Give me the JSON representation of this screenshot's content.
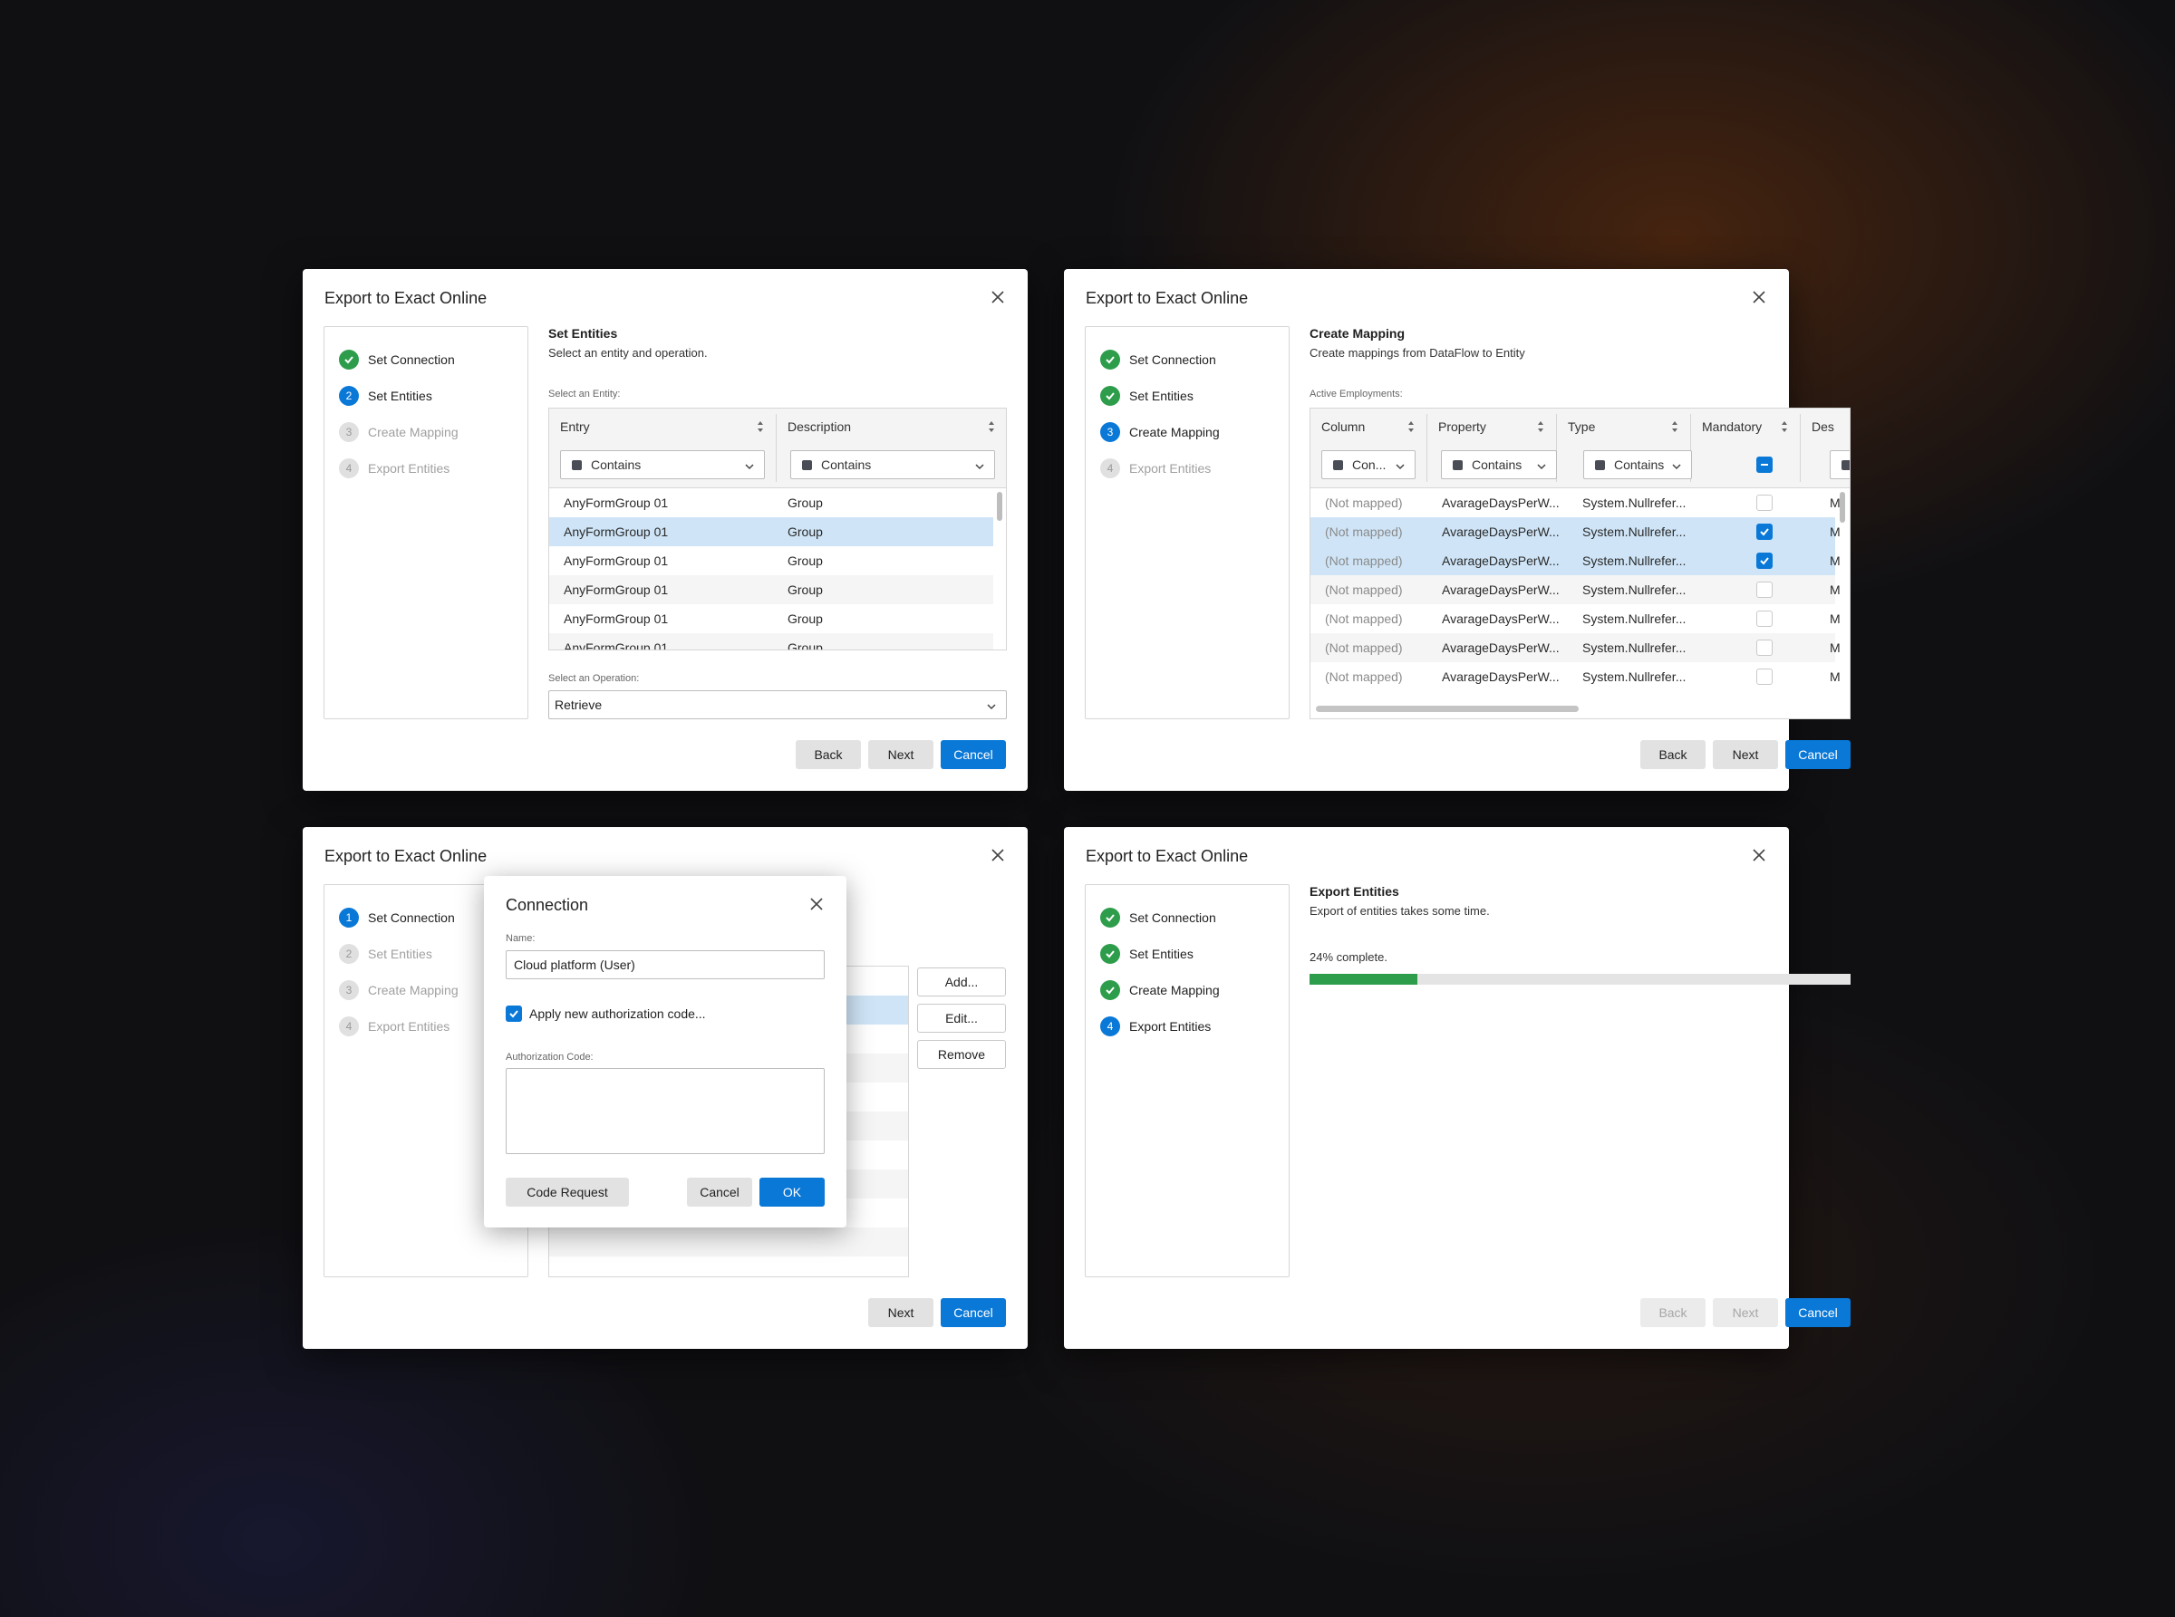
{
  "colors": {
    "accent": "#0a78d7",
    "success": "#2e9d4b",
    "selected_row": "#cfe5f7"
  },
  "step_labels": [
    "Set Connection",
    "Set Entities",
    "Create Mapping",
    "Export Entities"
  ],
  "dialog1": {
    "title": "Export to Exact Online",
    "steps": [
      {
        "num": "",
        "state": "done"
      },
      {
        "num": "2",
        "state": "active"
      },
      {
        "num": "3",
        "state": "pending"
      },
      {
        "num": "4",
        "state": "pending"
      }
    ],
    "section_title": "Set Entities",
    "section_sub": "Select an entity and operation.",
    "entity_label": "Select an Entity:",
    "columns": [
      "Entry",
      "Description"
    ],
    "filters": [
      "Contains",
      "Contains"
    ],
    "rows": [
      {
        "entry": "AnyFormGroup 01",
        "desc": "Group",
        "state": "normal"
      },
      {
        "entry": "AnyFormGroup 01",
        "desc": "Group",
        "state": "selected"
      },
      {
        "entry": "AnyFormGroup 01",
        "desc": "Group",
        "state": "normal"
      },
      {
        "entry": "AnyFormGroup 01",
        "desc": "Group",
        "state": "alt"
      },
      {
        "entry": "AnyFormGroup 01",
        "desc": "Group",
        "state": "normal"
      },
      {
        "entry": "AnyFormGroup 01",
        "desc": "Group",
        "state": "alt"
      }
    ],
    "operation_label": "Select an Operation:",
    "operation_value": "Retrieve",
    "buttons": {
      "back": "Back",
      "next": "Next",
      "cancel": "Cancel"
    }
  },
  "dialog2": {
    "title": "Export to Exact Online",
    "steps": [
      {
        "num": "",
        "state": "done"
      },
      {
        "num": "",
        "state": "done"
      },
      {
        "num": "3",
        "state": "active"
      },
      {
        "num": "4",
        "state": "pending"
      }
    ],
    "section_title": "Create Mapping",
    "section_sub": "Create mappings from DataFlow to Entity",
    "grid_label": "Active Employments:",
    "columns": [
      "Column",
      "Property",
      "Type",
      "Mandatory",
      "Des"
    ],
    "filters": [
      "Con...",
      "Contains",
      "Contains"
    ],
    "rows": [
      {
        "column": "(Not mapped)",
        "property": "AvarageDaysPerW...",
        "type": "System.Nullrefer...",
        "mandatory": false,
        "desc": "M",
        "state": "normal"
      },
      {
        "column": "(Not mapped)",
        "property": "AvarageDaysPerW...",
        "type": "System.Nullrefer...",
        "mandatory": true,
        "desc": "M",
        "state": "selected"
      },
      {
        "column": "(Not mapped)",
        "property": "AvarageDaysPerW...",
        "type": "System.Nullrefer...",
        "mandatory": true,
        "desc": "M",
        "state": "selected"
      },
      {
        "column": "(Not mapped)",
        "property": "AvarageDaysPerW...",
        "type": "System.Nullrefer...",
        "mandatory": false,
        "desc": "M",
        "state": "alt"
      },
      {
        "column": "(Not mapped)",
        "property": "AvarageDaysPerW...",
        "type": "System.Nullrefer...",
        "mandatory": false,
        "desc": "M",
        "state": "normal"
      },
      {
        "column": "(Not mapped)",
        "property": "AvarageDaysPerW...",
        "type": "System.Nullrefer...",
        "mandatory": false,
        "desc": "M",
        "state": "alt"
      },
      {
        "column": "(Not mapped)",
        "property": "AvarageDaysPerW...",
        "type": "System.Nullrefer...",
        "mandatory": false,
        "desc": "M",
        "state": "normal"
      }
    ],
    "buttons": {
      "back": "Back",
      "next": "Next",
      "cancel": "Cancel"
    }
  },
  "dialog3": {
    "title": "Export to Exact Online",
    "steps": [
      {
        "num": "1",
        "state": "active"
      },
      {
        "num": "2",
        "state": "pending"
      },
      {
        "num": "3",
        "state": "pending"
      },
      {
        "num": "4",
        "state": "pending"
      }
    ],
    "side_buttons": {
      "add": "Add...",
      "edit": "Edit...",
      "remove": "Remove"
    },
    "buttons": {
      "next": "Next",
      "cancel": "Cancel"
    },
    "popup": {
      "title": "Connection",
      "name_label": "Name:",
      "name_value": "Cloud platform (User)",
      "checkbox_label": "Apply new authorization code...",
      "checkbox_checked": true,
      "auth_label": "Authorization Code:",
      "auth_value": "",
      "code_request": "Code Request",
      "cancel": "Cancel",
      "ok": "OK"
    }
  },
  "dialog4": {
    "title": "Export to Exact Online",
    "steps": [
      {
        "num": "",
        "state": "done"
      },
      {
        "num": "",
        "state": "done"
      },
      {
        "num": "",
        "state": "done"
      },
      {
        "num": "4",
        "state": "active"
      }
    ],
    "section_title": "Export Entities",
    "section_sub": "Export of entities takes some time.",
    "progress_text": "24% complete.",
    "progress_fraction": 0.2,
    "buttons": {
      "back": "Back",
      "next": "Next",
      "cancel": "Cancel"
    }
  }
}
